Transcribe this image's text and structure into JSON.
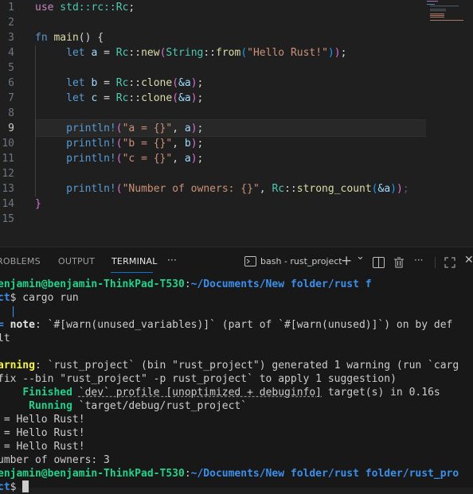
{
  "editor": {
    "line_numbers": [
      "1",
      "2",
      "3",
      "4",
      "5",
      "6",
      "7",
      "8",
      "9",
      "10",
      "11",
      "12",
      "13",
      "14",
      "15"
    ],
    "active_line": "9",
    "l1": {
      "use": "use",
      "path": " std::rc::",
      "ty": "Rc",
      "semi": ";"
    },
    "l3": {
      "fn": "fn",
      "name": " main",
      "rest": "() {"
    },
    "l4": {
      "let": "let",
      "var": " a",
      "eq": " = ",
      "ty": "Rc",
      "sep": "::",
      "new": "new",
      "p1": "(",
      "ty2": "String",
      "sep2": "::",
      "from": "from",
      "p2": "(",
      "str": "\"Hello Rust!\"",
      "p3": ")",
      "p4": ")",
      "semi": ";"
    },
    "l6": {
      "let": "let",
      "var": " b",
      "eq": " = ",
      "ty": "Rc",
      "sep": "::",
      "clone": "clone",
      "p1": "(",
      "arg": "&a",
      "p2": ")",
      "semi": ";"
    },
    "l7": {
      "let": "let",
      "var": " c",
      "eq": " = ",
      "ty": "Rc",
      "sep": "::",
      "clone": "clone",
      "p1": "(",
      "arg": "&a",
      "p2": ")",
      "semi": ";"
    },
    "l9": {
      "mac": "println!",
      "p1": "(",
      "str": "\"a = {}\"",
      "comma": ", ",
      "var": "a",
      "p2": ")",
      "semi": ";"
    },
    "l10": {
      "mac": "println!",
      "p1": "(",
      "str": "\"b = {}\"",
      "comma": ", ",
      "var": "b",
      "p2": ")",
      "semi": ";"
    },
    "l11": {
      "mac": "println!",
      "p1": "(",
      "str": "\"c = {}\"",
      "comma": ", ",
      "var": "a",
      "p2": ")",
      "semi": ";"
    },
    "l13": {
      "mac": "println!",
      "p1": "(",
      "str": "\"Number of owners: {}\"",
      "comma": ", ",
      "ty": "Rc",
      "sep": "::",
      "fn": "strong_count",
      "p2": "(",
      "arg": "&a",
      "p3": ")",
      "p4": ")",
      "semi": ";"
    },
    "l14": {
      "brace": "}"
    }
  },
  "panel": {
    "tabs": [
      "ROBLEMS",
      "OUTPUT",
      "TERMINAL"
    ],
    "active_tab": "TERMINAL",
    "more": "···",
    "terminal_name": "bash - rust_project",
    "plus": "+",
    "chev": "⌄",
    "more2": "···",
    "close": "✕"
  },
  "terminal": {
    "l1_user": "enjamin@benjamin-ThinkPad-T530",
    "l1_colon": ":",
    "l1_path": "~/Documents/New folder/rust f",
    "l2_path": "ct",
    "l2_cmd": "$ cargo run",
    "l3": "  |",
    "l4_pre": "= ",
    "l4_note": "note",
    "l4_rest": ": `#[warn(unused_variables)]` (part of `#[warn(unused)]`) on by def",
    "l5": "lt",
    "l7_warn": "arning",
    "l7_rest": ": `rust_project` (bin \"rust_project\") generated 1 warning (run `carg",
    "l8": "fix --bin \"rust_project\" -p rust_project` to apply 1 suggestion)",
    "l9_kw": "Finished",
    "l9_a": " ",
    "l9_profile": "`dev` profile [unoptimized + debuginfo]",
    "l9_rest": " target(s) in 0.16s",
    "l10_kw": "Running",
    "l10_rest": " `target/debug/rust_project`",
    "out1": " = Hello Rust!",
    "out2": " = Hello Rust!",
    "out3": " = Hello Rust!",
    "out4": "umber of owners: 3",
    "l15_user": "enjamin@benjamin-ThinkPad-T530",
    "l15_colon": ":",
    "l15_path": "~/Documents/New folder/rust folder/rust_pro",
    "l16_path": "ct",
    "l16_prompt": "$ "
  }
}
